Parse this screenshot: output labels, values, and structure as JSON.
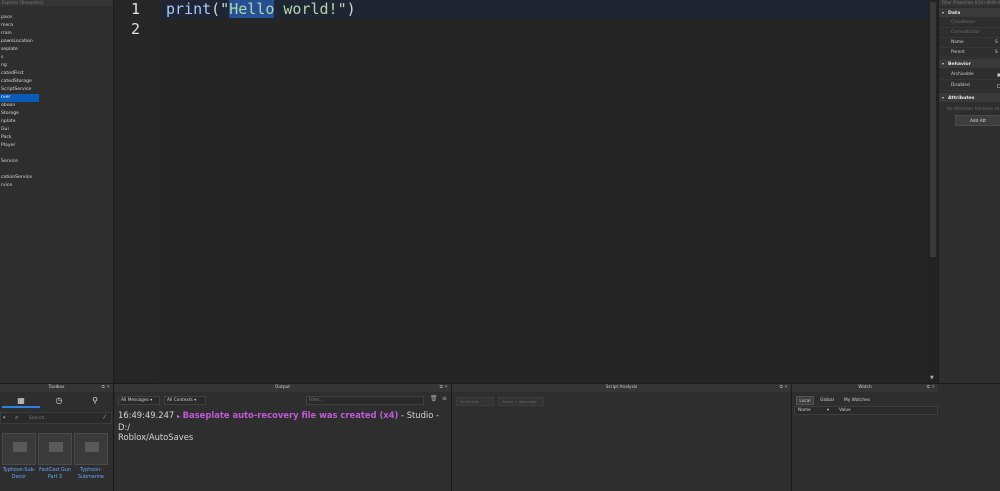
{
  "explorer": {
    "header": "Explorer [Baseplate]",
    "items": [
      "pace",
      "mera",
      "rrain",
      "pawnLocation",
      "seplate",
      "s",
      "ng",
      "catedFirst",
      "catedStorage",
      "ScriptService",
      "rver",
      "oboon",
      "Storage",
      "nplate",
      "Gui",
      "Pack",
      "Player",
      "",
      "Service",
      "",
      "cationService",
      "rvice"
    ],
    "selected_index": 10
  },
  "editor": {
    "line_numbers": [
      "1",
      "2"
    ],
    "code_line1": {
      "fn": "print",
      "open": "(\"",
      "selected": "Hello",
      "rest": " world!\"",
      "close": ")"
    }
  },
  "properties": {
    "header": "Filter Properties (Ctrl+Shift+P)",
    "sections": [
      {
        "title": "Data"
      },
      {
        "title": "Behavior"
      },
      {
        "title": "Attributes"
      }
    ],
    "data_rows": [
      {
        "label": "ClassName",
        "dim": true
      },
      {
        "label": "CurrentEditor",
        "dim": true
      },
      {
        "label": "Name",
        "value": "S"
      },
      {
        "label": "Parent",
        "value": "S"
      }
    ],
    "behavior_rows": [
      {
        "label": "Archivable",
        "checked": true
      },
      {
        "label": "Disabled",
        "checked": false
      }
    ],
    "attributes_note": "No Attributes has been ad",
    "add_attribute_label": "Add Att"
  },
  "toolbox": {
    "title": "Toolbox",
    "tabs": [
      "grid-icon",
      "clock-icon",
      "pin-icon"
    ],
    "search_placeholder": "Search",
    "items": [
      "Typhoon-Sub-Decor",
      "FastCast Gun Part 3",
      "Typhoon-Submarine"
    ]
  },
  "output": {
    "title": "Output",
    "messages_filter": "All Messages",
    "contexts_filter": "All Contexts",
    "filter_placeholder": "Filter...",
    "log": {
      "timestamp": "16:49:49.247",
      "arrow": "▸",
      "message": "Baseplate auto-recovery file was created (x4)",
      "rest": " -  Studio - D:/",
      "rest2": "Roblox/AutoSaves"
    }
  },
  "script_analysis": {
    "title": "Script Analysis",
    "btn1": "All Scripts",
    "btn2": "Errors + Warnings"
  },
  "watch": {
    "title": "Watch",
    "tabs": [
      "Local",
      "Global",
      "My Watches"
    ],
    "col_name": "Name",
    "col_value": "Value"
  }
}
